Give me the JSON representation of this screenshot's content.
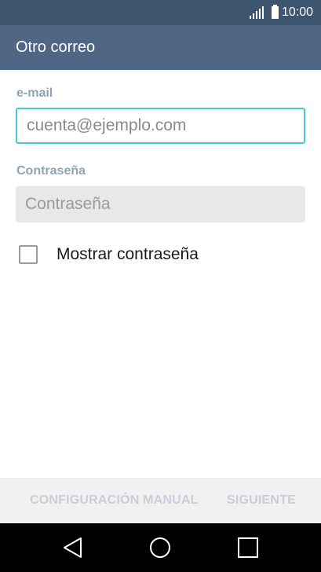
{
  "status_bar": {
    "time": "10:00",
    "icons": [
      "signal-icon",
      "battery-icon"
    ]
  },
  "app_bar": {
    "title": "Otro correo"
  },
  "form": {
    "email_label": "e-mail",
    "email_placeholder": "cuenta@ejemplo.com",
    "password_label": "Contraseña",
    "password_placeholder": "Contraseña",
    "show_password_label": "Mostrar contraseña",
    "show_password_checked": false
  },
  "actions": {
    "manual_setup": "CONFIGURACIÓN MANUAL",
    "next": "SIGUIENTE"
  },
  "nav_bar": {
    "icons": [
      "back-icon",
      "home-icon",
      "recents-icon"
    ]
  },
  "colors": {
    "status_bar": "#3e5570",
    "app_bar": "#4f6785",
    "accent": "#42cfd0",
    "label": "#8fa3b4",
    "disabled_action": "#c9ced6"
  }
}
